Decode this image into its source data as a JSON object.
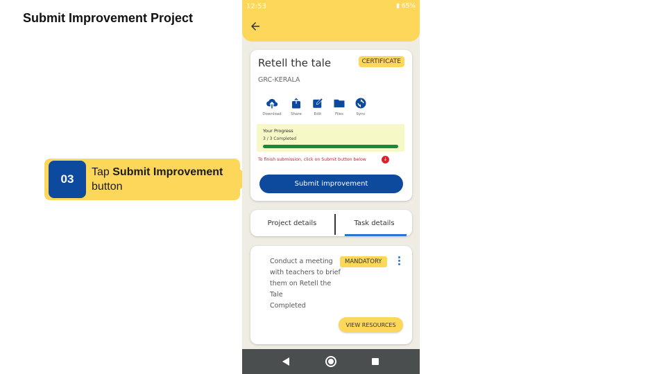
{
  "slide": {
    "title": "Submit Improvement Project",
    "callout": {
      "step": "03",
      "text_prefix": "Tap ",
      "text_bold": "Submit Improvement",
      "text_suffix": "button"
    }
  },
  "status_bar": {
    "time": "12:53",
    "battery": "65%"
  },
  "project": {
    "title": "Retell the tale",
    "badge": "CERTIFICATE",
    "org": "GRC-KERALA",
    "actions": [
      {
        "label": "Download",
        "icon": "cloud-download-icon"
      },
      {
        "label": "Share",
        "icon": "share-icon"
      },
      {
        "label": "Edit",
        "icon": "edit-icon"
      },
      {
        "label": "Files",
        "icon": "folder-icon"
      },
      {
        "label": "Sync",
        "icon": "sync-icon"
      }
    ],
    "progress": {
      "title": "Your Progress",
      "count": "3 / 3 Completed",
      "fraction": 1.0
    },
    "finish_note": "To finish submission, click on Submit button below",
    "submit_label": "Submit improvement"
  },
  "tabs": {
    "project_details": "Project details",
    "task_details": "Task details",
    "active": "task_details"
  },
  "task": {
    "description": "Conduct a meeting with teachers to brief them on Retell the Tale",
    "status": "Completed",
    "badge": "MANDATORY",
    "resources_label": "VIEW RESOURCES"
  },
  "colors": {
    "accent_yellow": "#fdd75a",
    "primary_blue": "#0d4a9e",
    "progress_green": "#188a3a",
    "alert_red": "#c8202b"
  }
}
